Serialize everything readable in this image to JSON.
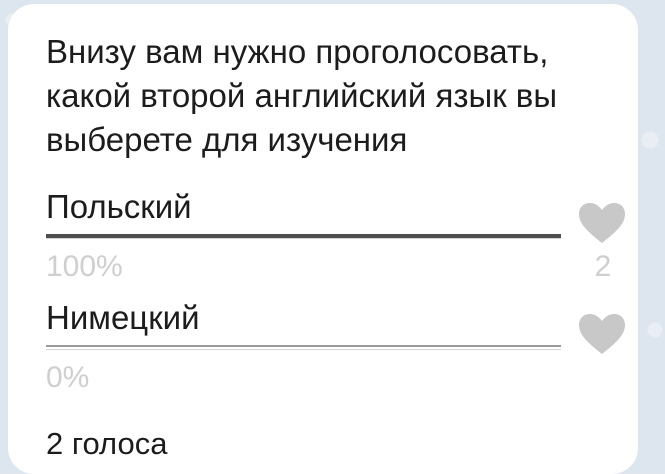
{
  "poll": {
    "question": "Внизу вам нужно проголосовать, какой второй английский язык вы выберете для изучения",
    "options": [
      {
        "label": "Польский",
        "percent_label": "100%",
        "vote_count": "2",
        "share": 1.0,
        "icon": "heart-icon"
      },
      {
        "label": "Нимецкий",
        "percent_label": "0%",
        "vote_count": "",
        "share": 0.0,
        "icon": "heart-icon"
      }
    ],
    "total_votes": "2 голоса"
  },
  "colors": {
    "background": "#dde5ee",
    "bubble": "#ffffff",
    "text": "#1c1c1c",
    "muted": "#cfcfcf",
    "bar_fill": "#4f4f4f",
    "heart": "#c8c8c8"
  }
}
